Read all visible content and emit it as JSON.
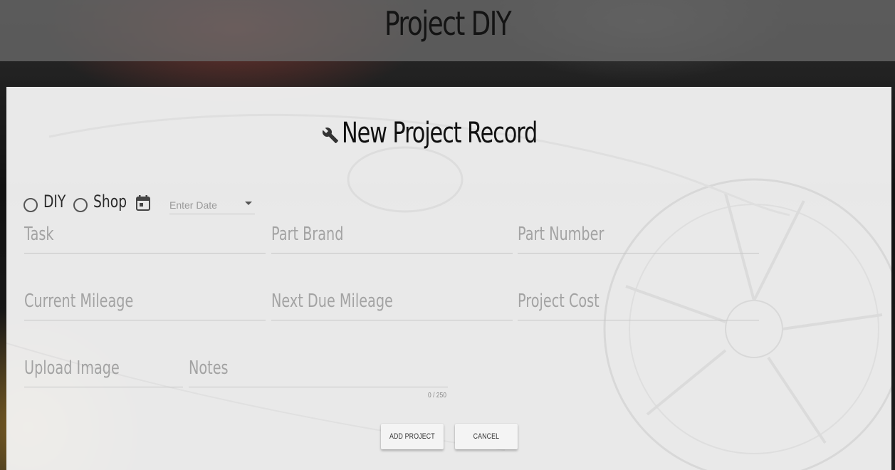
{
  "header": {
    "title": "Project DIY"
  },
  "form": {
    "title": "New Project Record",
    "title_icon": "wrench-icon",
    "service_type": {
      "options": [
        "DIY",
        "Shop"
      ],
      "selected": null
    },
    "date": {
      "placeholder": "Enter Date",
      "icon": "calendar-icon"
    },
    "fields": {
      "task": "Task",
      "part_brand": "Part Brand",
      "part_number": "Part Number",
      "current_mileage": "Current Mileage",
      "next_due_mileage": "Next Due Mileage",
      "project_cost": "Project Cost",
      "upload_image": "Upload Image",
      "notes": "Notes"
    },
    "notes_counter": "0 / 250",
    "buttons": {
      "add": "ADD PROJECT",
      "cancel": "CANCEL"
    }
  },
  "colors": {
    "header_bg": "#696969",
    "card_bg": "#f4f4f4",
    "label_gray": "#a3a3a3",
    "text_dark": "#111111"
  }
}
